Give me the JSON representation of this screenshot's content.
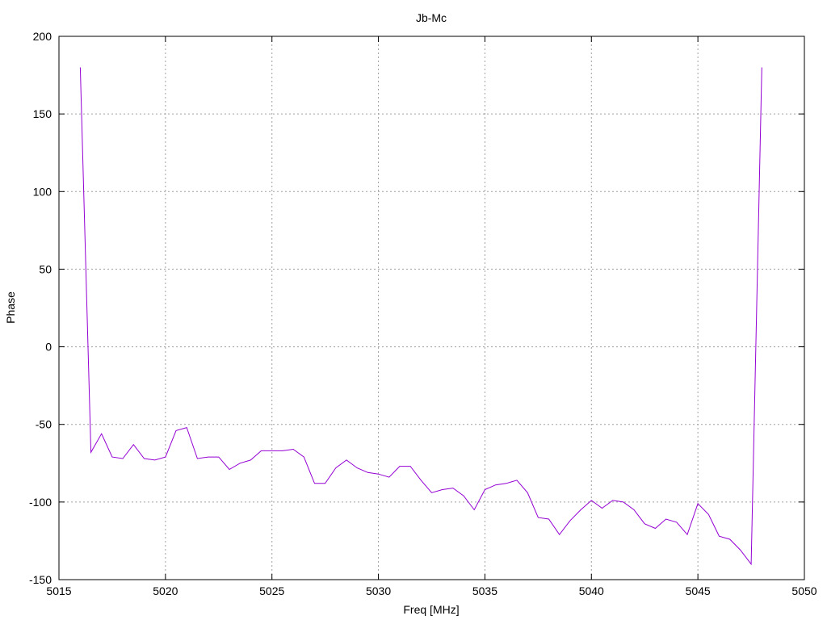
{
  "chart_data": {
    "type": "line",
    "title": "Jb-Mc",
    "xlabel": "Freq [MHz]",
    "ylabel": "Phase",
    "xlim": [
      5015,
      5050
    ],
    "ylim": [
      -150,
      200
    ],
    "xticks": [
      5015,
      5020,
      5025,
      5030,
      5035,
      5040,
      5045,
      5050
    ],
    "yticks": [
      -150,
      -100,
      -50,
      0,
      50,
      100,
      150,
      200
    ],
    "grid": true,
    "line_color": "#9400d3",
    "series": [
      {
        "x": [
          5016.0,
          5016.5,
          5017.0,
          5017.5,
          5018.0,
          5018.5,
          5019.0,
          5019.5,
          5020.0,
          5020.5,
          5021.0,
          5021.5,
          5022.0,
          5022.5,
          5023.0,
          5023.5,
          5024.0,
          5024.5,
          5025.0,
          5025.5,
          5026.0,
          5026.5,
          5027.0,
          5027.5,
          5028.0,
          5028.5,
          5029.0,
          5029.5,
          5030.0,
          5030.5,
          5031.0,
          5031.5,
          5032.0,
          5032.5,
          5033.0,
          5033.5,
          5034.0,
          5034.5,
          5035.0,
          5035.5,
          5036.0,
          5036.5,
          5037.0,
          5037.5,
          5038.0,
          5038.5,
          5039.0,
          5039.5,
          5040.0,
          5040.5,
          5041.0,
          5041.5,
          5042.0,
          5042.5,
          5043.0,
          5043.5,
          5044.0,
          5044.5,
          5045.0,
          5045.5,
          5046.0,
          5046.5,
          5047.0,
          5047.5,
          5048.0
        ],
        "y": [
          180,
          -68,
          -56,
          -71,
          -72,
          -63,
          -72,
          -73,
          -71,
          -54,
          -52,
          -72,
          -71,
          -71,
          -79,
          -75,
          -73,
          -67,
          -67,
          -67,
          -66,
          -71,
          -88,
          -88,
          -78,
          -73,
          -78,
          -81,
          -82,
          -84,
          -77,
          -77,
          -86,
          -94,
          -92,
          -91,
          -96,
          -105,
          -92,
          -89,
          -88,
          -86,
          -94,
          -110,
          -111,
          -121,
          -112,
          -105,
          -99,
          -104,
          -99,
          -100,
          -105,
          -114,
          -117,
          -111,
          -113,
          -121,
          -101,
          -108,
          -122,
          -124,
          -131,
          -140,
          180
        ]
      }
    ]
  }
}
